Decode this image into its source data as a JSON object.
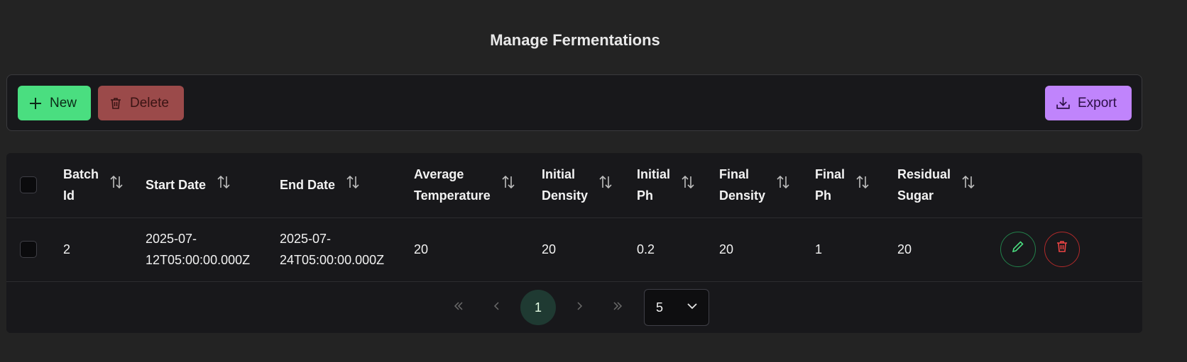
{
  "page": {
    "title": "Manage Fermentations"
  },
  "toolbar": {
    "new_label": "New",
    "delete_label": "Delete",
    "export_label": "Export"
  },
  "table": {
    "columns": [
      {
        "line1": "Batch",
        "line2": "Id"
      },
      {
        "line1": "Start Date",
        "line2": ""
      },
      {
        "line1": "End Date",
        "line2": ""
      },
      {
        "line1": "Average",
        "line2": "Temperature"
      },
      {
        "line1": "Initial",
        "line2": "Density"
      },
      {
        "line1": "Initial",
        "line2": "Ph"
      },
      {
        "line1": "Final",
        "line2": "Density"
      },
      {
        "line1": "Final",
        "line2": "Ph"
      },
      {
        "line1": "Residual",
        "line2": "Sugar"
      }
    ],
    "rows": [
      {
        "batch_id": "2",
        "start_date_1": "2025-07-",
        "start_date_2": "12T05:00:00.000Z",
        "end_date_1": "2025-07-",
        "end_date_2": "24T05:00:00.000Z",
        "average_temperature": "20",
        "initial_density": "20",
        "initial_ph": "0.2",
        "final_density": "20",
        "final_ph": "1",
        "residual_sugar": "20"
      }
    ]
  },
  "paginator": {
    "current_page": "1",
    "rows_per_page": "5"
  },
  "colors": {
    "new": "#4ade80",
    "delete": "#9b4a4a",
    "export": "#c084fc",
    "edit_ring": "#22804a",
    "delete_ring": "#b02a2a"
  }
}
